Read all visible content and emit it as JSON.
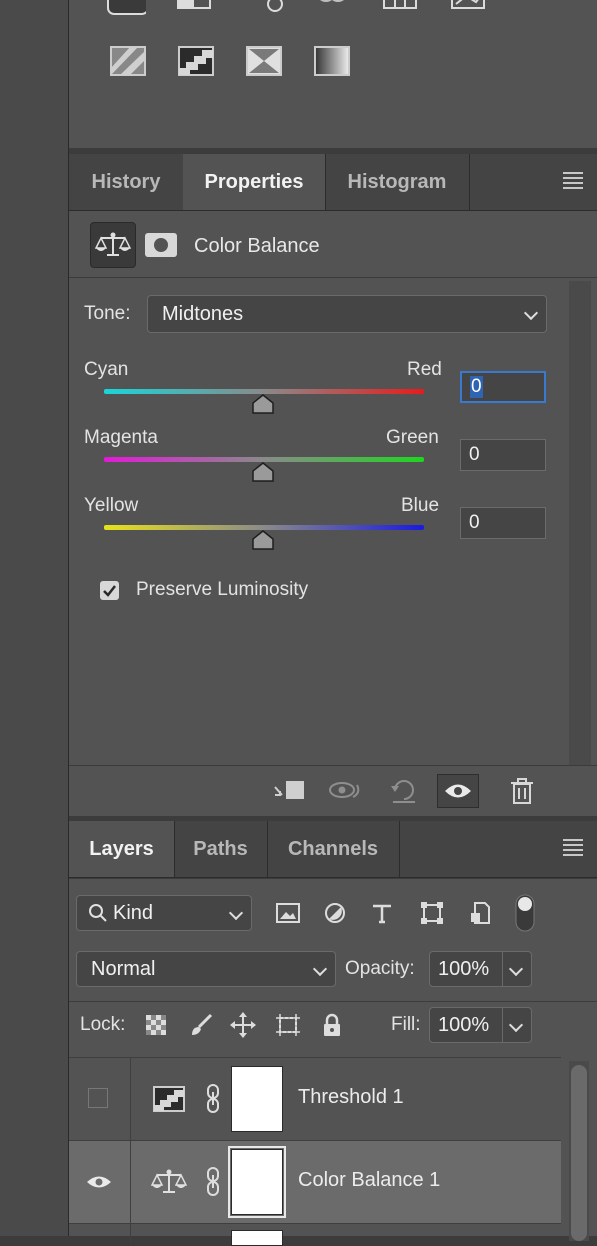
{
  "colors": {
    "panel_bg": "#535353",
    "tab_bar_bg": "#444444",
    "focus_blue": "#3a79d0"
  },
  "adjustments": {
    "icons_row2": [
      "posterize-icon",
      "threshold-icon",
      "selective-color-icon",
      "gradient-map-icon"
    ]
  },
  "tabs_top": [
    {
      "label": "History"
    },
    {
      "label": "Properties"
    },
    {
      "label": "Histogram"
    }
  ],
  "properties": {
    "title": "Color Balance",
    "tone_label": "Tone:",
    "tone_value": "Midtones",
    "sliders": [
      {
        "left": "Cyan",
        "right": "Red",
        "value": "0"
      },
      {
        "left": "Magenta",
        "right": "Green",
        "value": "0"
      },
      {
        "left": "Yellow",
        "right": "Blue",
        "value": "0"
      }
    ],
    "preserve_luminosity": "Preserve Luminosity",
    "preserve_checked": true
  },
  "tabs_bottom": [
    {
      "label": "Layers"
    },
    {
      "label": "Paths"
    },
    {
      "label": "Channels"
    }
  ],
  "layers": {
    "filter_kind": "Kind",
    "blend_mode": "Normal",
    "opacity_label": "Opacity:",
    "opacity_value": "100%",
    "lock_label": "Lock:",
    "fill_label": "Fill:",
    "fill_value": "100%",
    "items": [
      {
        "name": "Threshold 1",
        "visible": false,
        "selected": false
      },
      {
        "name": "Color Balance 1",
        "visible": true,
        "selected": true
      }
    ]
  }
}
